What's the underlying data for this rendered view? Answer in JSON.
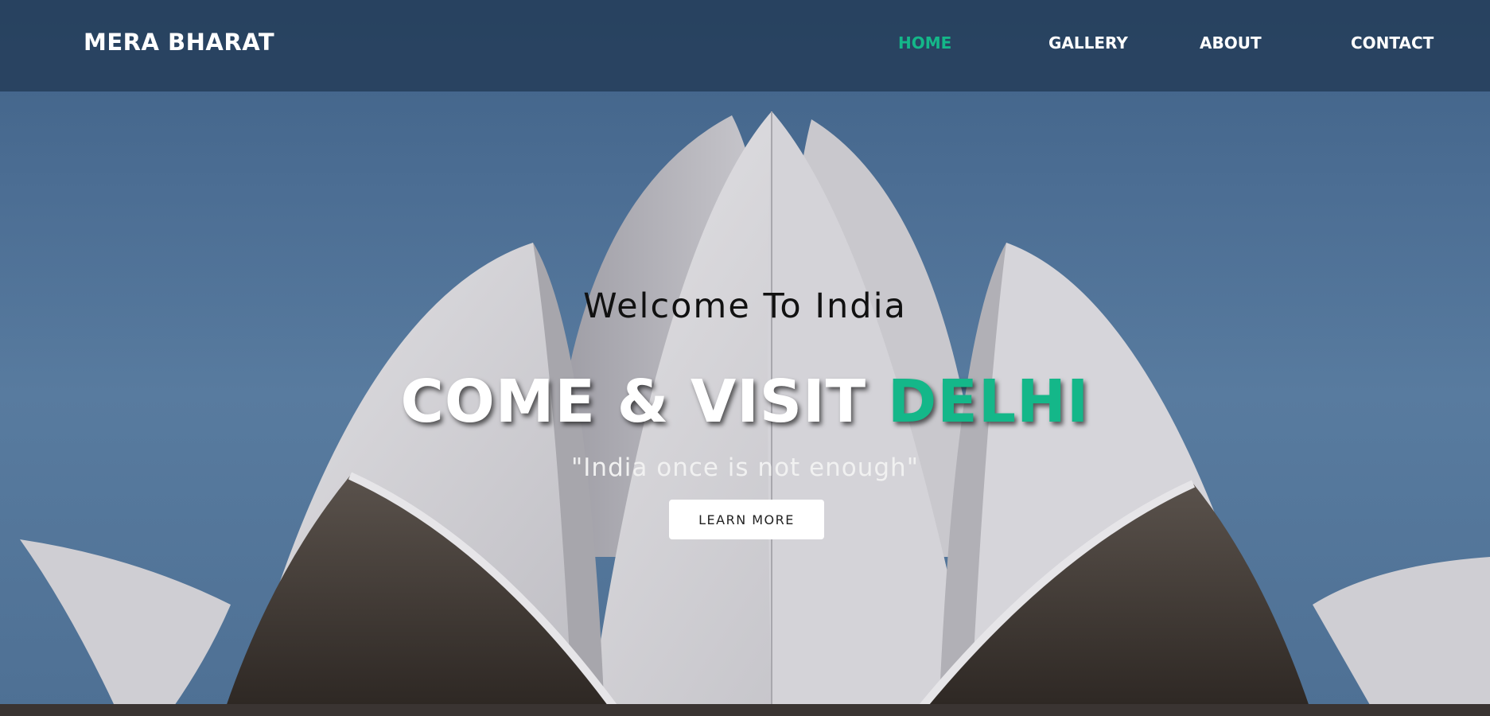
{
  "nav": {
    "brand": "MERA BHARAT",
    "links": [
      {
        "label": "HOME",
        "active": true
      },
      {
        "label": "GALLERY",
        "active": false
      },
      {
        "label": "ABOUT",
        "active": false
      },
      {
        "label": "CONTACT",
        "active": false
      }
    ]
  },
  "hero": {
    "welcome": "Welcome To India",
    "headline_main": "COME & VISIT ",
    "headline_accent": "DELHI",
    "tagline": "\"India once is not enough\"",
    "cta_label": "LEARN MORE"
  },
  "colors": {
    "accent": "#14b789",
    "navbar": "#233c58",
    "sky": "#4b6d93"
  }
}
